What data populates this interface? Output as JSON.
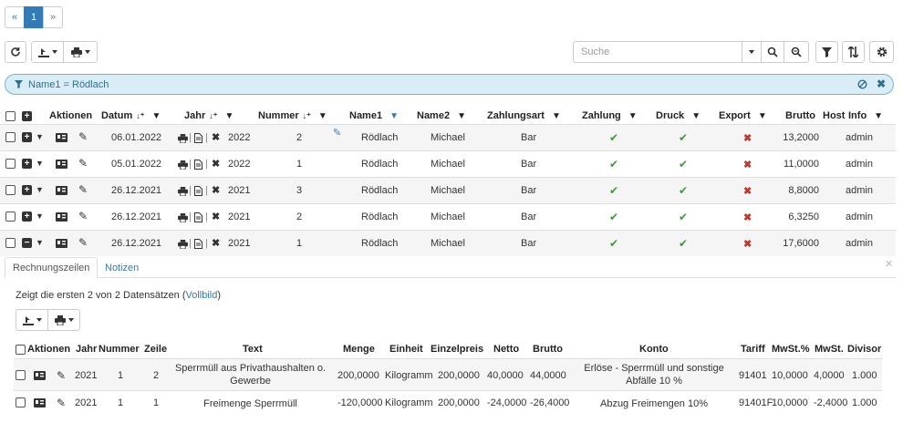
{
  "pagination": {
    "prev": "«",
    "current": "1",
    "next": "»"
  },
  "search": {
    "placeholder": "Suche"
  },
  "filter": {
    "text": "Name1 = Rödlach"
  },
  "main_table": {
    "headers": {
      "aktionen": "Aktionen",
      "datum": "Datum",
      "jahr": "Jahr",
      "nummer": "Nummer",
      "name1": "Name1",
      "name2": "Name2",
      "zahlungsart": "Zahlungsart",
      "zahlung": "Zahlung",
      "druck": "Druck",
      "export": "Export",
      "brutto": "Brutto",
      "host": "Host",
      "info": "Info"
    },
    "rows": [
      {
        "datum": "06.01.2022",
        "jahr": "2022",
        "nummer": "2",
        "name1": "Rödlach",
        "name2": "Michael",
        "zahlungsart": "Bar",
        "brutto": "13,2000",
        "host": "admin"
      },
      {
        "datum": "05.01.2022",
        "jahr": "2022",
        "nummer": "1",
        "name1": "Rödlach",
        "name2": "Michael",
        "zahlungsart": "Bar",
        "brutto": "11,0000",
        "host": "admin"
      },
      {
        "datum": "26.12.2021",
        "jahr": "2021",
        "nummer": "3",
        "name1": "Rödlach",
        "name2": "Michael",
        "zahlungsart": "Bar",
        "brutto": "8,8000",
        "host": "admin"
      },
      {
        "datum": "26.12.2021",
        "jahr": "2021",
        "nummer": "2",
        "name1": "Rödlach",
        "name2": "Michael",
        "zahlungsart": "Bar",
        "brutto": "6,3250",
        "host": "admin"
      },
      {
        "datum": "26.12.2021",
        "jahr": "2021",
        "nummer": "1",
        "name1": "Rödlach",
        "name2": "Michael",
        "zahlungsart": "Bar",
        "brutto": "17,6000",
        "host": "admin"
      }
    ]
  },
  "detail": {
    "tabs": [
      "Rechnungszeilen",
      "Notizen"
    ],
    "info_text": "Zeigt die ersten 2 von 2 Datensätzen (",
    "info_link": "Vollbild",
    "info_end": ")",
    "headers": {
      "aktionen": "Aktionen",
      "jahr": "Jahr",
      "nummer": "Nummer",
      "zeile": "Zeile",
      "text": "Text",
      "menge": "Menge",
      "einheit": "Einheit",
      "einzelpreis": "Einzelpreis",
      "netto": "Netto",
      "brutto": "Brutto",
      "konto": "Konto",
      "tariff": "Tariff",
      "mwst_pct": "MwSt.%",
      "mwst": "MwSt.",
      "divisor": "Divisor"
    },
    "rows": [
      {
        "jahr": "2021",
        "nummer": "1",
        "zeile": "2",
        "text1": "Sperrmüll aus Privathaushalten o.",
        "text2": "Gewerbe",
        "menge": "200,0000",
        "einheit": "Kilogramm",
        "einzelpreis": "200,0000",
        "netto": "40,0000",
        "brutto": "44,0000",
        "konto1": "Erlöse - Sperrmüll und sonstige",
        "konto2": "Abfälle 10 %",
        "tariff": "91401",
        "mwst_pct": "10,0000",
        "mwst": "4,0000",
        "divisor": "1.000"
      },
      {
        "jahr": "2021",
        "nummer": "1",
        "zeile": "1",
        "text1": "Freimenge Sperrmüll",
        "text2": "",
        "menge": "-120,0000",
        "einheit": "Kilogramm",
        "einzelpreis": "200,0000",
        "netto": "-24,0000",
        "brutto": "-26,4000",
        "konto1": "Abzug Freimengen 10%",
        "konto2": "",
        "tariff": "91401F",
        "mwst_pct": "10,0000",
        "mwst": "-2,4000",
        "divisor": "1.000"
      }
    ]
  },
  "colors": {
    "primary": "#337ab7",
    "check": "#3c9a3c",
    "cross": "#c0392b",
    "filter_bg": "#d9edf7"
  }
}
